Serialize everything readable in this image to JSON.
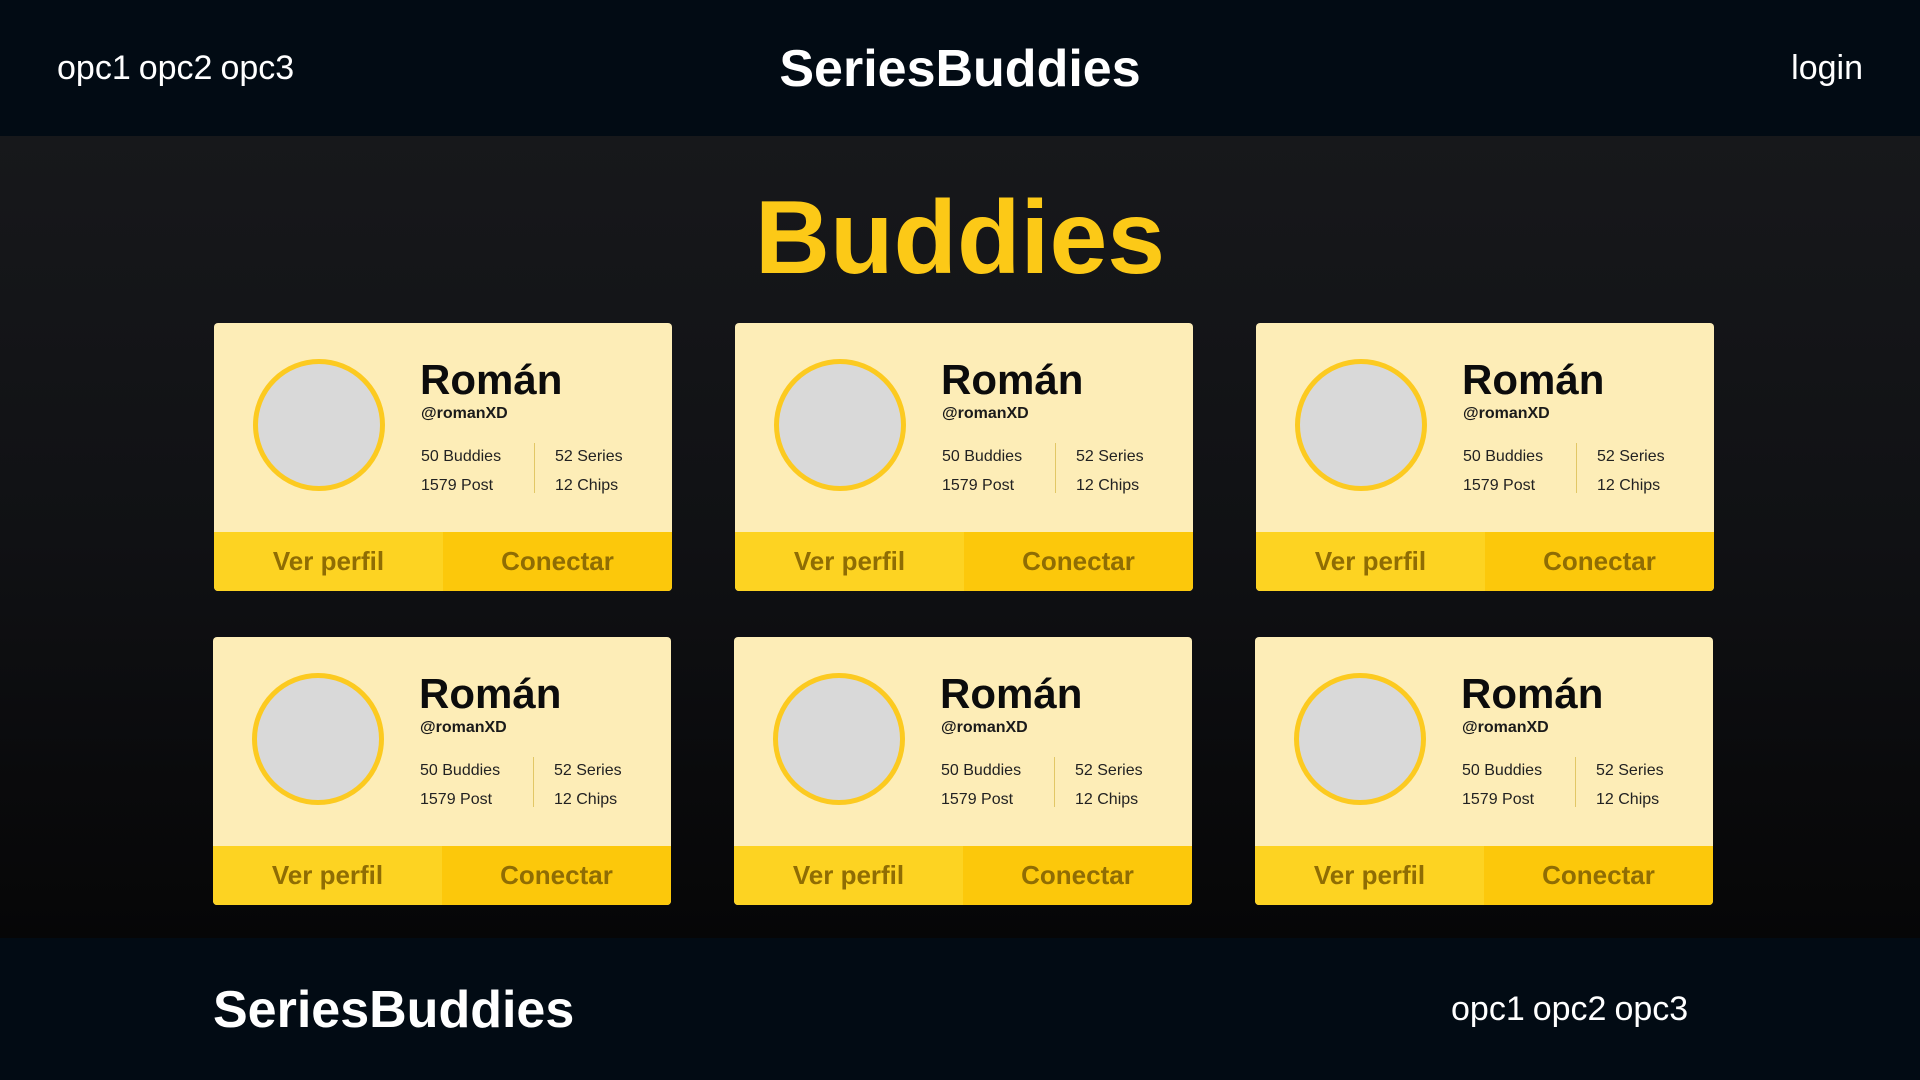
{
  "header": {
    "nav": [
      "opc1",
      "opc2",
      "opc3"
    ],
    "logo": "SeriesBuddies",
    "login": "login"
  },
  "main": {
    "title": "Buddies",
    "cards": [
      {
        "name": "Román",
        "handle": "@romanXD",
        "buddies": "50 Buddies",
        "posts": "1579 Post",
        "series": "52 Series",
        "chips": "12 Chips",
        "view_label": "Ver perfil",
        "connect_label": "Conectar"
      },
      {
        "name": "Román",
        "handle": "@romanXD",
        "buddies": "50 Buddies",
        "posts": "1579 Post",
        "series": "52 Series",
        "chips": "12 Chips",
        "view_label": "Ver perfil",
        "connect_label": "Conectar"
      },
      {
        "name": "Román",
        "handle": "@romanXD",
        "buddies": "50 Buddies",
        "posts": "1579 Post",
        "series": "52 Series",
        "chips": "12 Chips",
        "view_label": "Ver perfil",
        "connect_label": "Conectar"
      },
      {
        "name": "Román",
        "handle": "@romanXD",
        "buddies": "50 Buddies",
        "posts": "1579 Post",
        "series": "52 Series",
        "chips": "12 Chips",
        "view_label": "Ver perfil",
        "connect_label": "Conectar"
      },
      {
        "name": "Román",
        "handle": "@romanXD",
        "buddies": "50 Buddies",
        "posts": "1579 Post",
        "series": "52 Series",
        "chips": "12 Chips",
        "view_label": "Ver perfil",
        "connect_label": "Conectar"
      },
      {
        "name": "Román",
        "handle": "@romanXD",
        "buddies": "50 Buddies",
        "posts": "1579 Post",
        "series": "52 Series",
        "chips": "12 Chips",
        "view_label": "Ver perfil",
        "connect_label": "Conectar"
      }
    ]
  },
  "footer": {
    "logo": "SeriesBuddies",
    "nav": [
      "opc1",
      "opc2",
      "opc3"
    ]
  },
  "colors": {
    "accent": "#fcc917",
    "card_bg": "#fdedb7",
    "button_text": "#8f6d04",
    "bar_bg": "#020b14"
  }
}
